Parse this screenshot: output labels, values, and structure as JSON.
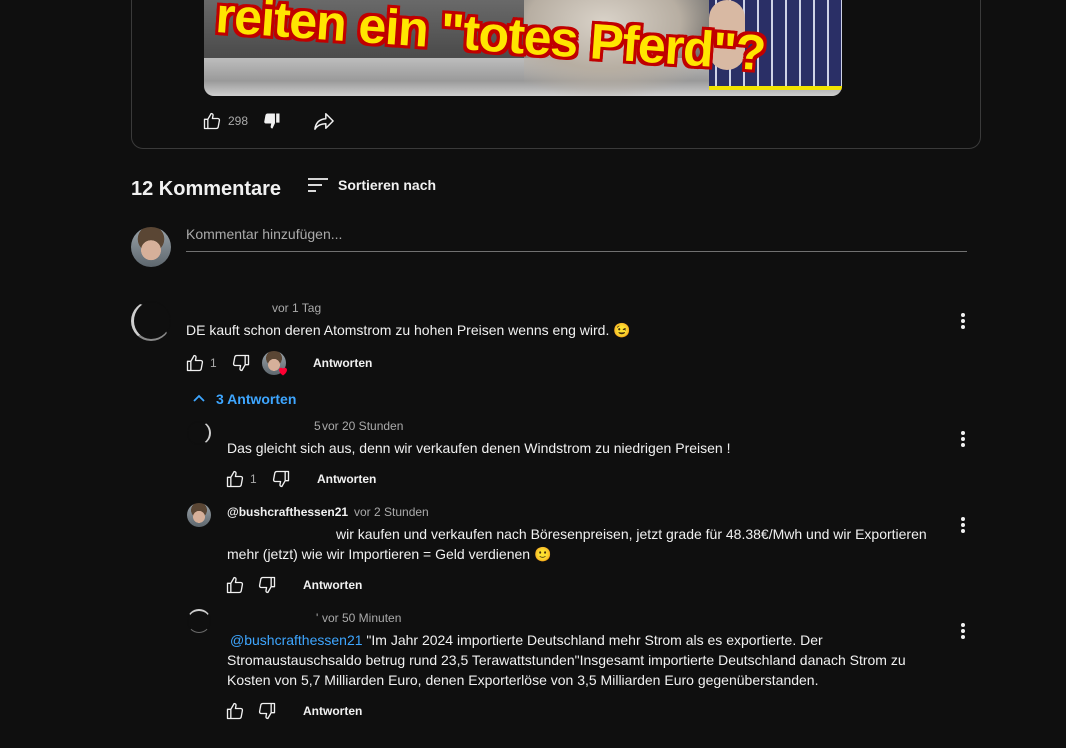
{
  "video": {
    "thumbnail_text": "reiten ein \"totes Pferd\"?",
    "like_count": "298"
  },
  "comments_section": {
    "heading": "12 Kommentare",
    "sort_label": "Sortieren nach",
    "add_comment_placeholder": "Kommentar hinzufügen..."
  },
  "comments": [
    {
      "time": "vor 1 Tag",
      "text": "DE kauft schon deren Atomstrom zu hohen Preisen wenns eng wird. 😉",
      "like_count": "1",
      "reply_label": "Antworten",
      "replies_toggle": "3 Antworten"
    }
  ],
  "replies": [
    {
      "handle_fragment": "5",
      "time": "vor 20 Stunden",
      "text": "Das gleicht sich aus, denn wir verkaufen denen Windstrom zu niedrigen Preisen !",
      "like_count": "1",
      "reply_label": "Antworten"
    },
    {
      "handle": "@bushcrafthessen21",
      "time": "vor 2 Stunden",
      "text_line1": "wir kaufen und verkaufen nach Böresenpreisen, jetzt grade für 48.38€/Mwh und wir Exportieren",
      "text_line2": "mehr (jetzt) wie wir Importieren = Geld verdienen  🙂",
      "reply_label": "Antworten"
    },
    {
      "handle_fragment": "'",
      "time": "vor 50 Minuten",
      "mention": "@bushcrafthessen21",
      "text_line1": " \"Im Jahr 2024 importierte Deutschland mehr Strom als es exportierte. Der",
      "text_line2": "Stromaustauschsaldo betrug rund 23,5 Terawattstunden\"Insgesamt importierte Deutschland danach Strom zu",
      "text_line3": "Kosten von 5,7 Milliarden Euro, denen Exporterlöse von 3,5 Milliarden Euro gegenüberstanden.",
      "reply_label": "Antworten"
    }
  ],
  "colors": {
    "background": "#0f0f0f",
    "text": "#f1f1f1",
    "secondary_text": "#aaaaaa",
    "link": "#3ea6ff",
    "heart": "#ff0033"
  }
}
